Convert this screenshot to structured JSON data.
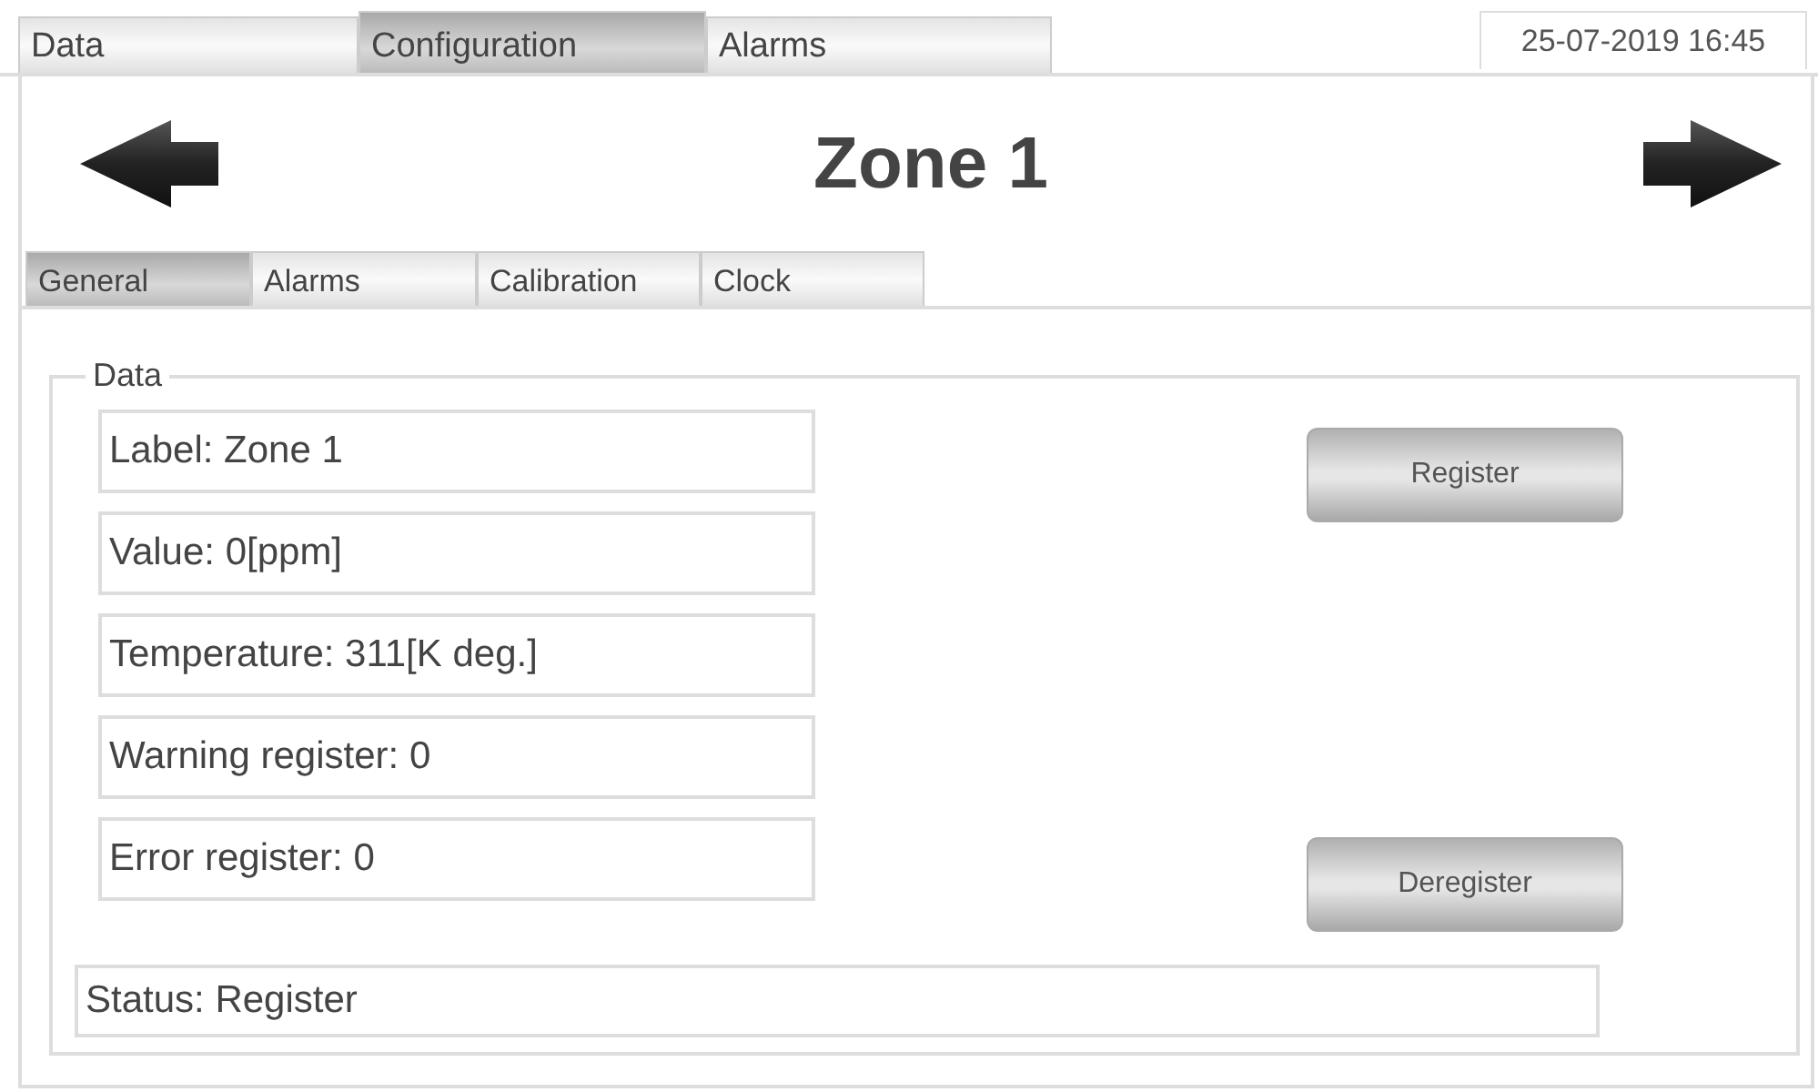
{
  "main_tabs": [
    {
      "label": "Data",
      "selected": false
    },
    {
      "label": "Configuration",
      "selected": true
    },
    {
      "label": "Alarms",
      "selected": false
    }
  ],
  "datetime": "25-07-2019 16:45",
  "title": "Zone 1",
  "sub_tabs": [
    {
      "label": "General",
      "selected": true
    },
    {
      "label": "Alarms",
      "selected": false
    },
    {
      "label": "Calibration",
      "selected": false
    },
    {
      "label": "Clock",
      "selected": false
    }
  ],
  "group": {
    "legend": "Data",
    "fields": [
      "Label: Zone 1",
      "Value: 0[ppm]",
      "Temperature: 311[K deg.]",
      "Warning register: 0",
      "Error register: 0"
    ],
    "buttons": [
      "Register",
      "Deregister"
    ],
    "status": "Status: Register"
  }
}
